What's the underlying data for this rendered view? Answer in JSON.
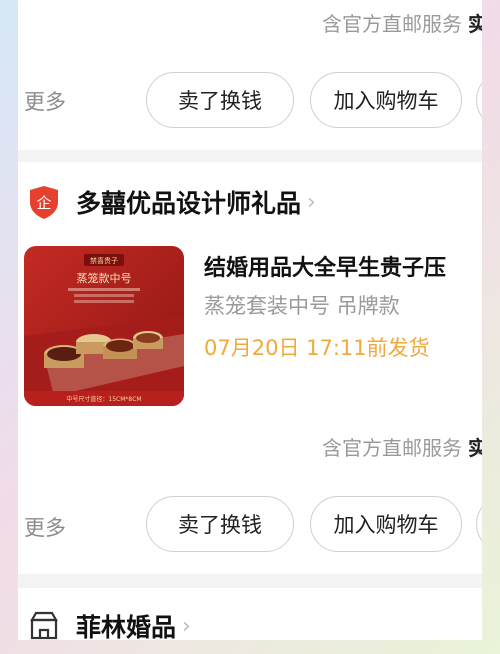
{
  "top_card": {
    "service_text": "含官方直邮服务",
    "service_suffix": "实",
    "more_label": "更多",
    "sell_button": "卖了换钱",
    "cart_button": "加入购物车"
  },
  "main_card": {
    "shop_name": "多囍优品设计师礼品",
    "shop_badge": "企",
    "product": {
      "title": "结婚用品大全早生贵子压",
      "spec": "蒸笼套装中号  吊牌款",
      "ship_time": "07月20日 17:11前发货",
      "image_caption_top": "禁喜贵子",
      "image_caption_main": "蒸笼款中号",
      "image_caption_bottom": "中号尺寸直径：15CM*8CM"
    },
    "service_text": "含官方直邮服务",
    "service_suffix": "实",
    "more_label": "更多",
    "sell_button": "卖了换钱",
    "cart_button": "加入购物车"
  },
  "bottom_card": {
    "shop_name": "菲林婚品"
  },
  "colors": {
    "accent_orange": "#f0a93c",
    "badge_red": "#e8402e",
    "product_red": "#b8201e"
  }
}
